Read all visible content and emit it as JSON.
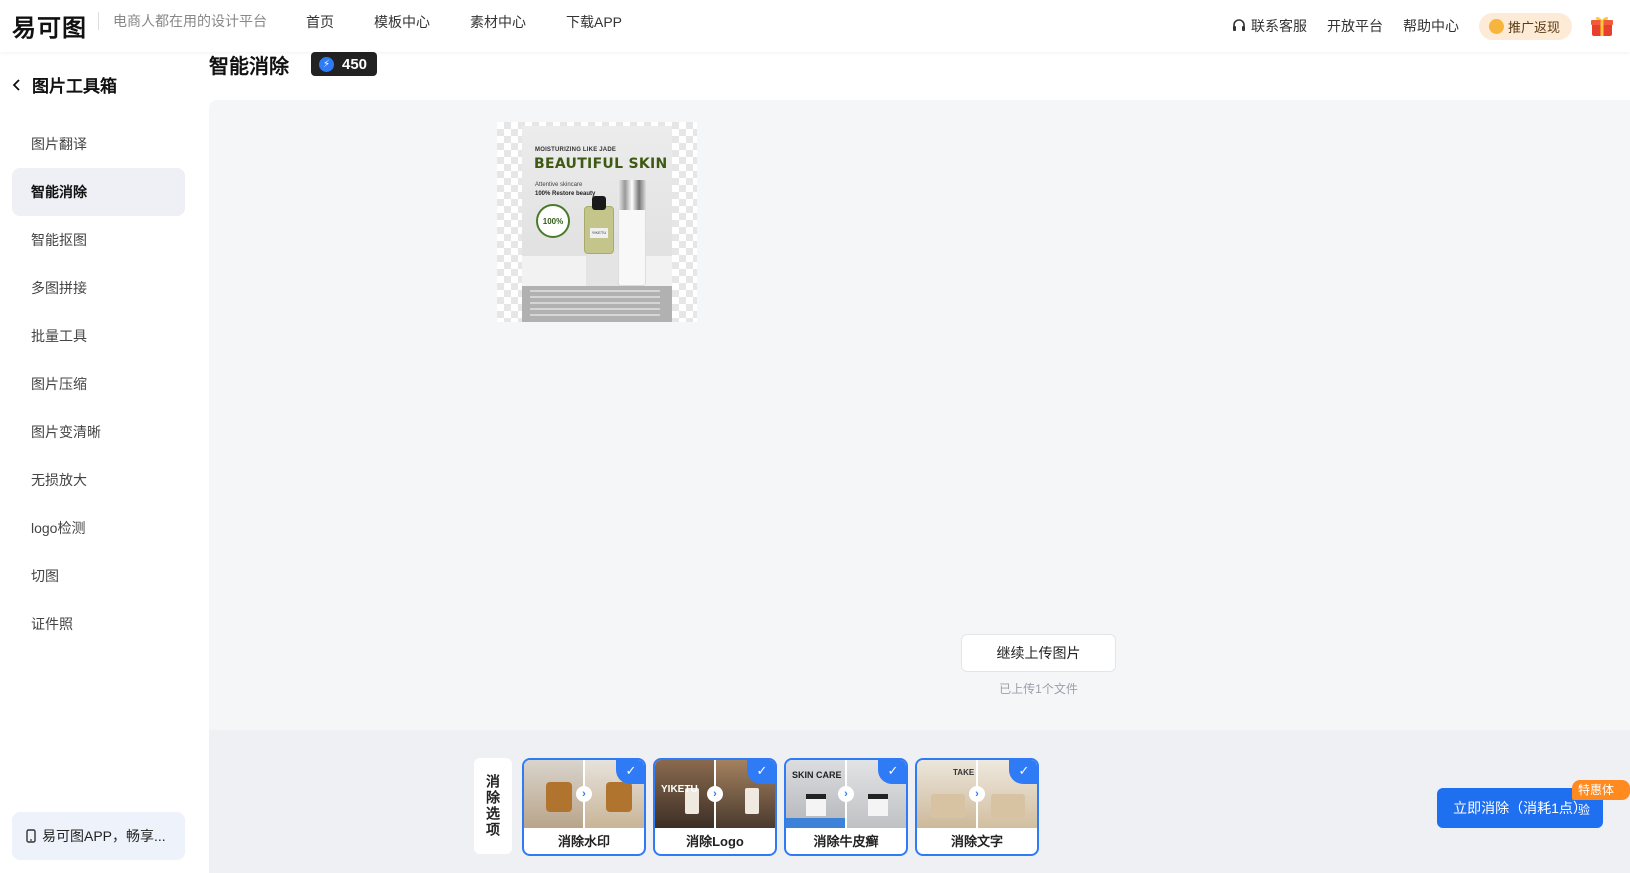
{
  "header": {
    "logo": "易可图",
    "slogan": "电商人都在用的设计平台",
    "nav": [
      "首页",
      "模板中心",
      "素材中心",
      "下载APP"
    ],
    "contact": "联系客服",
    "open_platform": "开放平台",
    "help": "帮助中心",
    "promo": "推广返现"
  },
  "sidebar": {
    "title": "图片工具箱",
    "items": [
      {
        "label": "图片翻译"
      },
      {
        "label": "智能消除"
      },
      {
        "label": "智能抠图"
      },
      {
        "label": "多图拼接"
      },
      {
        "label": "批量工具"
      },
      {
        "label": "图片压缩"
      },
      {
        "label": "图片变清晰"
      },
      {
        "label": "无损放大"
      },
      {
        "label": "logo检测"
      },
      {
        "label": "切图"
      },
      {
        "label": "证件照"
      }
    ],
    "active_index": 1,
    "app_banner": "易可图APP，畅享..."
  },
  "main": {
    "title": "智能消除",
    "points": "450",
    "poster": {
      "small_text": "MOISTURIZING LIKE JADE",
      "title": "BEAUTIFUL SKIN",
      "line1": "Attentive skincare",
      "line2": "100% Restore beauty",
      "seal": "100%",
      "label": "YIKETU"
    },
    "upload_button": "继续上传图片",
    "upload_note": "已上传1个文件"
  },
  "options": {
    "label": "消除选项",
    "cards": [
      {
        "caption": "消除水印",
        "overlay": "",
        "selected": true
      },
      {
        "caption": "消除Logo",
        "overlay": "YIKETU",
        "selected": true
      },
      {
        "caption": "消除牛皮癣",
        "overlay": "SKIN CARE",
        "selected": true
      },
      {
        "caption": "消除文字",
        "overlay": "TAKE",
        "selected": true
      }
    ]
  },
  "action": {
    "button": "立即消除（消耗1点）",
    "tag": "特惠体验"
  },
  "colors": {
    "accent": "#1f6ff1",
    "active_bg": "#eef0f5",
    "promo_bg": "#fdebd7",
    "tag": "#ff8a1f"
  },
  "icons": {
    "back": "chevron-left-icon",
    "contact": "headset-icon",
    "points": "lightning-icon",
    "phone": "phone-icon",
    "gift": "gift-icon",
    "check": "check-icon",
    "arrow": "chevron-right-icon"
  }
}
